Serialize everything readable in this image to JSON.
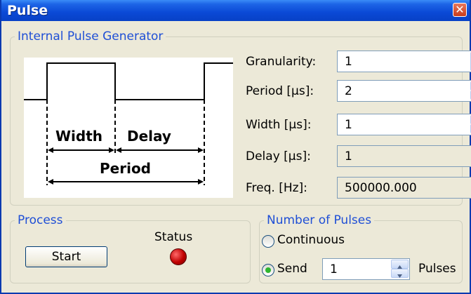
{
  "window": {
    "title": "Pulse"
  },
  "generator": {
    "legend": "Internal Pulse Generator",
    "diagram": {
      "width_label": "Width",
      "delay_label": "Delay",
      "period_label": "Period"
    },
    "granularity": {
      "label": "Granularity:",
      "value": "1"
    },
    "period": {
      "label": "Period [µs]:",
      "value": "2"
    },
    "width": {
      "label": "Width [µs]:",
      "value": "1"
    },
    "delay": {
      "label": "Delay [µs]:",
      "value": "1"
    },
    "freq": {
      "label": "Freq. [Hz]:",
      "value": "500000.000"
    }
  },
  "process": {
    "legend": "Process",
    "start_label": "Start",
    "status_label": "Status",
    "status_color": "#cc0000"
  },
  "pulses": {
    "legend": "Number of Pulses",
    "continuous_label": "Continuous",
    "send_label": "Send",
    "count": "1",
    "pulses_label": "Pulses",
    "selected": "send"
  }
}
